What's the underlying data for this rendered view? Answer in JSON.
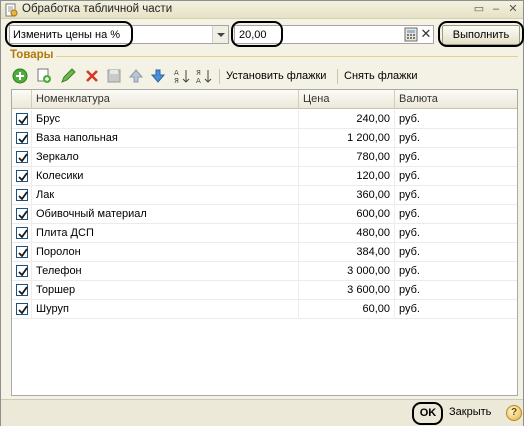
{
  "window": {
    "title": "Обработка табличной части"
  },
  "controls": {
    "action_value": "Изменить цены на %",
    "percent_value": "20,00",
    "execute_label": "Выполнить"
  },
  "group": {
    "title": "Товары"
  },
  "toolbar": {
    "icons": [
      "add-icon",
      "copy-icon",
      "edit-icon",
      "delete-icon",
      "save-icon",
      "move-up-icon",
      "move-down-icon",
      "sort-ascending-icon",
      "sort-descending-icon"
    ],
    "set_flags_label": "Установить флажки",
    "clear_flags_label": "Снять флажки"
  },
  "table": {
    "columns": [
      "Номенклатура",
      "Цена",
      "Валюта"
    ],
    "rows": [
      {
        "checked": true,
        "name": "Брус",
        "price": "240,00",
        "currency": "руб."
      },
      {
        "checked": true,
        "name": "Ваза напольная",
        "price": "1 200,00",
        "currency": "руб."
      },
      {
        "checked": true,
        "name": "Зеркало",
        "price": "780,00",
        "currency": "руб."
      },
      {
        "checked": true,
        "name": "Колесики",
        "price": "120,00",
        "currency": "руб."
      },
      {
        "checked": true,
        "name": "Лак",
        "price": "360,00",
        "currency": "руб."
      },
      {
        "checked": true,
        "name": "Обивочный материал",
        "price": "600,00",
        "currency": "руб."
      },
      {
        "checked": true,
        "name": "Плита ДСП",
        "price": "480,00",
        "currency": "руб."
      },
      {
        "checked": true,
        "name": "Поролон",
        "price": "384,00",
        "currency": "руб."
      },
      {
        "checked": true,
        "name": "Телефон",
        "price": "3 000,00",
        "currency": "руб."
      },
      {
        "checked": true,
        "name": "Торшер",
        "price": "3 600,00",
        "currency": "руб."
      },
      {
        "checked": true,
        "name": "Шуруп",
        "price": "60,00",
        "currency": "руб."
      }
    ]
  },
  "footer": {
    "ok_label": "OK",
    "close_label": "Закрыть",
    "help_label": "?"
  },
  "colors": {
    "group_title": "#b0790b",
    "checkbox_border": "#1c5180",
    "window_bg": "#f4f2e4"
  }
}
